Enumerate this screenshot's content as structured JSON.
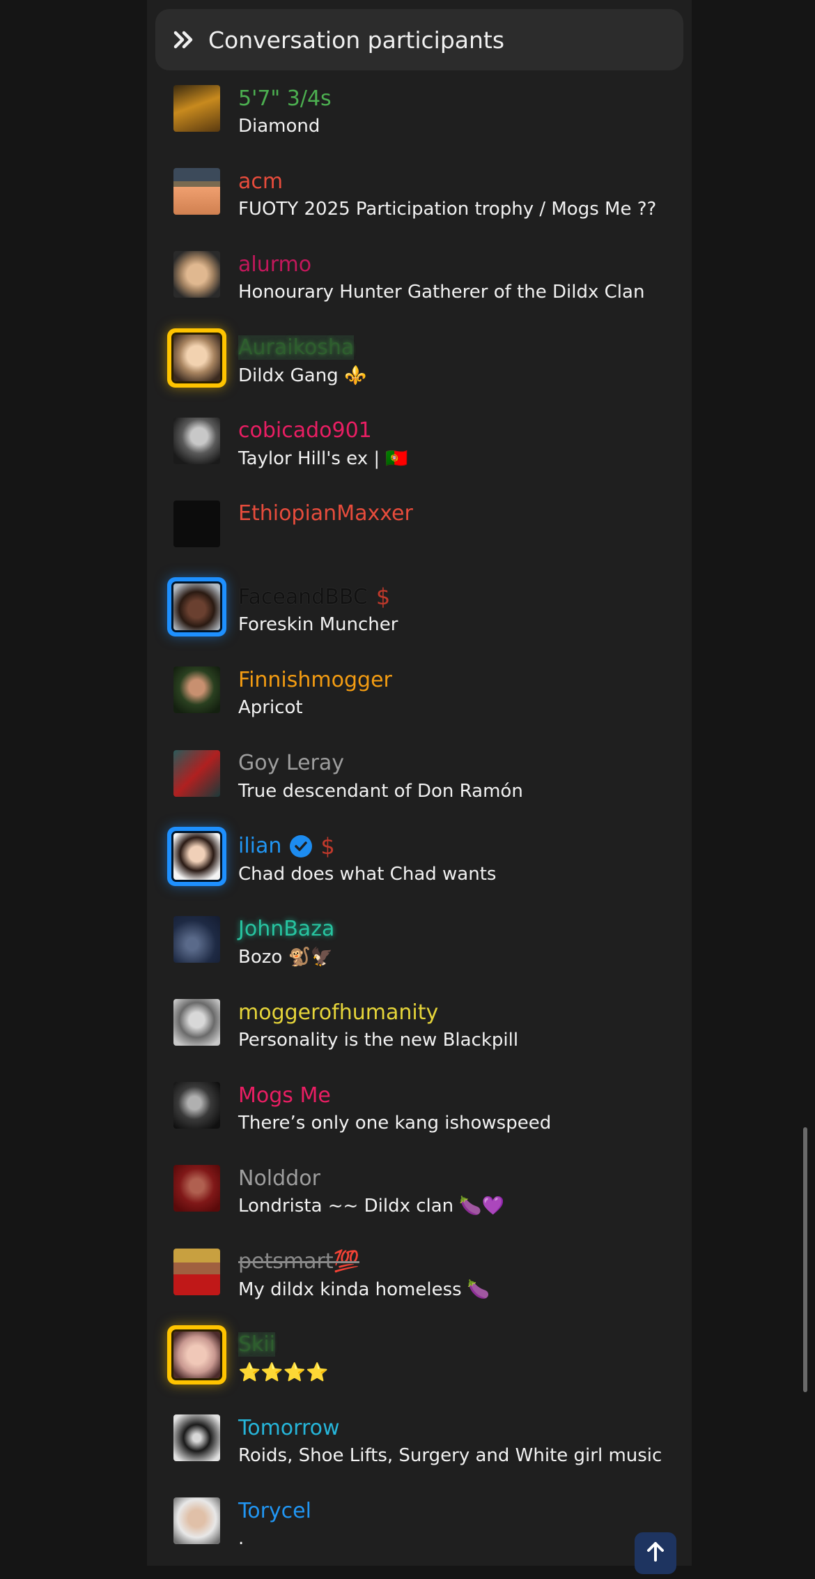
{
  "header": {
    "title": "Conversation participants",
    "icon": "double-chevron-right-icon"
  },
  "participants": [
    {
      "name": "5'7\" 3/4s",
      "title": "Diamond",
      "name_color": "#4caf50"
    },
    {
      "name": "acm",
      "title": "FUOTY 2025 Participation trophy / Mogs Me ??",
      "name_color": "#e74c3c"
    },
    {
      "name": "alurmo",
      "title": "Honourary Hunter Gatherer of the Dildx Clan",
      "name_color": "#c2185b"
    },
    {
      "name": "Auraikosha",
      "title": "Dildx Gang ⚜️",
      "name_color": "#2e5e2e",
      "frame": "gold"
    },
    {
      "name": "cobicado901",
      "title": "Taylor Hill's ex | 🇵🇹",
      "name_color": "#e91e63"
    },
    {
      "name": "EthiopianMaxxer",
      "title": "",
      "name_color": "#e74c3c"
    },
    {
      "name": "FaceandBBC",
      "title": "Foreskin Muncher",
      "name_color": "#111111",
      "frame": "blue",
      "badge": "$"
    },
    {
      "name": "Finnishmogger",
      "title": "Apricot",
      "name_color": "#f39c12"
    },
    {
      "name": "Goy Leray",
      "title": "True descendant of Don Ramón",
      "name_color": "#9e9e9e"
    },
    {
      "name": "ilian",
      "title": "Chad does what Chad wants",
      "name_color": "#2196f3",
      "frame": "blue",
      "verified": true,
      "badge": "$"
    },
    {
      "name": "JohnBaza",
      "title": "Bozo 🐒🦅",
      "name_color": "#27c4a0"
    },
    {
      "name": "moggerofhumanity",
      "title": "Personality is the new Blackpill",
      "name_color": "#e6d53a"
    },
    {
      "name": "Mogs Me",
      "title": "There’s only one kang ishowspeed",
      "name_color": "#e91e63"
    },
    {
      "name": "Nolddor",
      "title": "Londrista ~~ Dildx clan 🍆💜",
      "name_color": "#9e9e9e"
    },
    {
      "name": "petsmart💯",
      "title": "My dildx kinda homeless 🍆",
      "name_color": "#8a8a8a",
      "strike": true
    },
    {
      "name": "Skii",
      "title": "⭐⭐⭐⭐",
      "name_color": "#2e5e2e",
      "frame": "gold"
    },
    {
      "name": "Tomorrow",
      "title": "Roids, Shoe Lifts, Surgery and White girl music",
      "name_color": "#26b5d9"
    },
    {
      "name": "Torycel",
      "title": ".",
      "name_color": "#2196f3"
    }
  ]
}
